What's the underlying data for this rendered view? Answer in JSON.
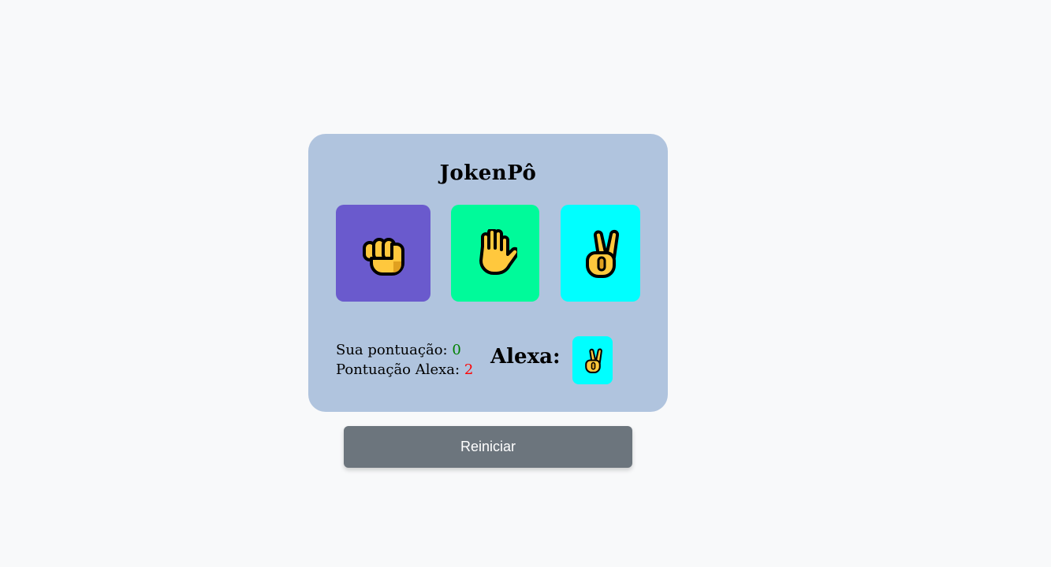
{
  "game": {
    "title": "JokenPô",
    "choices": [
      {
        "name": "rock",
        "icon": "fist-icon",
        "color": "#6a5acd"
      },
      {
        "name": "paper",
        "icon": "raised-hand-icon",
        "color": "#00fa9a"
      },
      {
        "name": "scissors",
        "icon": "victory-hand-icon",
        "color": "#00ffff"
      }
    ]
  },
  "scoreboard": {
    "user_label": "Sua pontuação: ",
    "user_score": "0",
    "alexa_label": "Pontuação Alexa: ",
    "alexa_score": "2",
    "user_score_color": "#008000",
    "alexa_score_color": "#ff0000"
  },
  "alexa": {
    "label": "Alexa:",
    "choice_icon": "victory-hand-icon",
    "choice_color": "#00ffff"
  },
  "controls": {
    "restart_label": "Reiniciar"
  },
  "colors": {
    "page_background": "#f8f9fa",
    "card_background": "#b0c4de",
    "button_background": "#6c757d"
  }
}
